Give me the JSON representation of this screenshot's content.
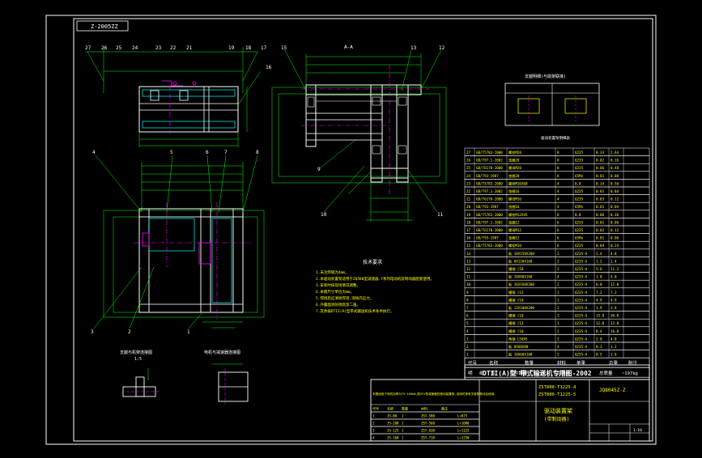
{
  "drawing": {
    "tag_label": "Z-2005ZZ",
    "section_label": "A-A",
    "title_main": "DTII(A)型 带式输送机专用图-2002",
    "drawing_no": "JQ8045Z-Z",
    "part_code_1": "ZST800-T1225-4",
    "part_code_2": "ZST800-T1225-5",
    "part_name_1": "驱动装置架",
    "part_name_2": "(带制动器)",
    "scale": "1:10",
    "weight_label": "总质量",
    "weight_value": "~197kg",
    "tech_title": "技术要求",
    "tech_notes": [
      "1.未注焊缝为4mm。",
      "2.本驱动装置架适用于ZQ500型减速器,Y系列电动机及制动器配套使用。",
      "3.安装时按现场情况调整。",
      "4.本图尺寸单位为mm。",
      "5.焊接后应清除焊渣,消除内应力。",
      "6.外露面涂防锈底漆二遍。",
      "7.其余按DTII(A)型带式输送机技术条件执行。"
    ],
    "detail_label_1": "支腿与机架连接图",
    "detail_label_2": "电机与减速器连接图",
    "detail_scale": "1:5",
    "small_table_title": "支腿明细(与底架联接)",
    "parts_table_title": "驱动装置架明细表",
    "parts_header": [
      "序号",
      "代号",
      "名称",
      "数量",
      "材料",
      "单重",
      "总重",
      "备注"
    ],
    "parts_rows": [
      [
        "27",
        "GB/T5783-2000",
        "螺栓M20",
        "8",
        "Q235",
        "0.33",
        "2.64"
      ],
      [
        "26",
        "GB/T97.1-2002",
        "垫圈20",
        "8",
        "Q235",
        "0.02",
        "0.16"
      ],
      [
        "25",
        "GB/T6170-2000",
        "螺母M20",
        "8",
        "Q235",
        "0.06",
        "0.48"
      ],
      [
        "24",
        "GB/T93-1987",
        "垫圈20",
        "8",
        "65Mn",
        "0.01",
        "0.08"
      ],
      [
        "23",
        "GB/T5783-2000",
        "螺栓M16X60",
        "4",
        "8.8",
        "0.14",
        "0.56"
      ],
      [
        "22",
        "GB/T97.1-2002",
        "垫圈16",
        "4",
        "Q235",
        "0.01",
        "0.04"
      ],
      [
        "21",
        "GB/T6170-2000",
        "螺母M16",
        "4",
        "Q235",
        "0.03",
        "0.12"
      ],
      [
        "20",
        "GB/T93-1987",
        "垫圈16",
        "4",
        "65Mn",
        "0.01",
        "0.04"
      ],
      [
        "19",
        "GB/T5783-2000",
        "螺栓M12X45",
        "6",
        "8.8",
        "0.06",
        "0.36"
      ],
      [
        "18",
        "GB/T97.1-2002",
        "垫圈12",
        "6",
        "Q235",
        "0.01",
        "0.06"
      ],
      [
        "17",
        "GB/T6170-2000",
        "螺母M12",
        "6",
        "Q235",
        "0.02",
        "0.12"
      ],
      [
        "16",
        "GB/T93-1987",
        "垫圈12",
        "6",
        "65Mn",
        "0.01",
        "0.06"
      ],
      [
        "15",
        "GB/T5783-2000",
        "螺栓M10",
        "6",
        "Q235",
        "0.04",
        "0.24"
      ],
      [
        "14",
        "",
        "板 10X150X200",
        "2",
        "Q235-A",
        "2.4",
        "4.8"
      ],
      [
        "13",
        "",
        "板 8X120X160",
        "2",
        "Q235-A",
        "1.2",
        "2.4"
      ],
      [
        "12",
        "",
        "槽钢 [10",
        "2",
        "Q235-A",
        "5.6",
        "11.2"
      ],
      [
        "11",
        "",
        "板 10X80X160",
        "4",
        "Q235-A",
        "1.0",
        "4.0"
      ],
      [
        "10",
        "",
        "板 16X160X300",
        "2",
        "Q235-A",
        "6.0",
        "12.0"
      ],
      [
        "9",
        "",
        "槽钢 [12",
        "1",
        "Q235-A",
        "7.2",
        "7.2"
      ],
      [
        "8",
        "",
        "槽钢 [10",
        "1",
        "Q235-A",
        "4.9",
        "4.9"
      ],
      [
        "7",
        "",
        "板 12X100X200",
        "2",
        "Q235-A",
        "1.9",
        "3.8"
      ],
      [
        "6",
        "",
        "槽钢 [10",
        "2",
        "Q235-A",
        "15.0",
        "30.0"
      ],
      [
        "5",
        "",
        "槽钢 [12",
        "1",
        "Q235-A",
        "12.0",
        "12.0"
      ],
      [
        "4",
        "",
        "槽钢 [10",
        "2",
        "Q235-A",
        "8.4",
        "16.8"
      ],
      [
        "3",
        "",
        "角钢 L50X5",
        "2",
        "Q235-A",
        "2.0",
        "4.0"
      ],
      [
        "2",
        "",
        "板 8X60X80",
        "4",
        "Q235-A",
        "0.3",
        "1.2"
      ],
      [
        "1",
        "",
        "板 10X60X100",
        "2",
        "Q235-A",
        "0.5",
        "1.0"
      ]
    ],
    "footer_labels": [
      "代号",
      "名称",
      "数量",
      "材料",
      "单重",
      "总重",
      "附注"
    ],
    "footer_row2": [
      "明",
      "细",
      "表",
      "(共件数量",
      "一台",
      "之量)"
    ],
    "bottom_small_table": [
      [
        "代号",
        "名称",
        "数量",
        "材料",
        "备注"
      ],
      [
        "1",
        "JS-80",
        "1",
        "ZSY-500",
        "",
        "L=875"
      ],
      [
        "2",
        "JS-100",
        "1",
        "ZSY-560",
        "",
        "L=1000"
      ],
      [
        "3",
        "JS-125",
        "1",
        "ZSY-630",
        "",
        "L=1125"
      ],
      [
        "4",
        "JS-160",
        "1",
        "ZSY-710",
        "",
        "L=1250"
      ]
    ],
    "note_text": "本图适用于电机功率为75~160kW,配ZSY型减速器的驱动装置架,选用时按有关参数核对后使用。"
  },
  "colors": {
    "frame": "#ffffff",
    "outline": "#ffffff",
    "dim": "#00ff00",
    "center": "#ff00ff",
    "text": "#ffff00",
    "hidden": "#00ffff",
    "table": "#ffffff"
  }
}
